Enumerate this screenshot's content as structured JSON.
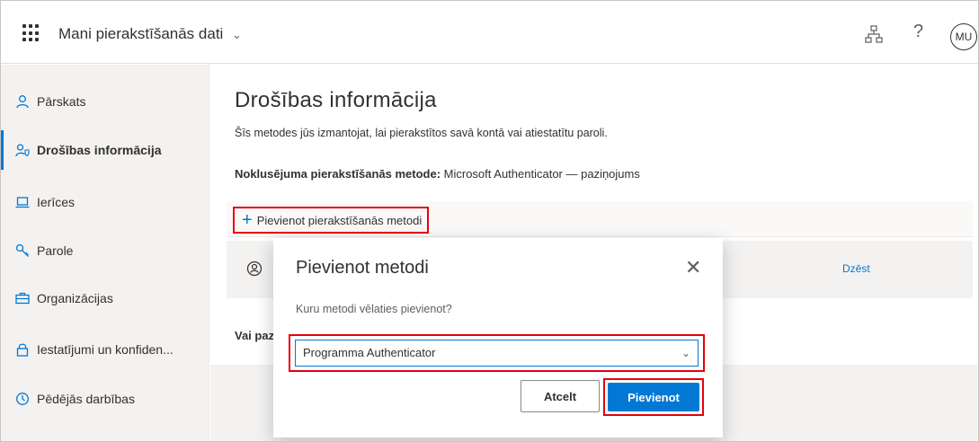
{
  "header": {
    "app_title": "Mani pierakstīšanās dati",
    "avatar_initials": "MU",
    "help_glyph": "?"
  },
  "sidebar": {
    "items": [
      {
        "label": "Pārskats",
        "icon": "person-icon",
        "active": false
      },
      {
        "label": "Drošības informācija",
        "icon": "security-info-icon",
        "active": true
      },
      {
        "label": "Ierīces",
        "icon": "laptop-icon",
        "active": false
      },
      {
        "label": "Parole",
        "icon": "key-icon",
        "active": false
      },
      {
        "label": "Organizācijas",
        "icon": "briefcase-icon",
        "active": false
      },
      {
        "label": "Iestatījumi un konfiden...",
        "icon": "lock-icon",
        "active": false
      },
      {
        "label": "Pēdējās darbības",
        "icon": "history-icon",
        "active": false
      }
    ]
  },
  "main": {
    "title": "Drošības informācija",
    "description": "Šīs metodes jūs izmantojat, lai pierakstītos savā kontā vai atiestatītu paroli.",
    "default_method_label": "Noklusējuma pierakstīšanās metode:",
    "default_method_value": "Microsoft Authenticator — paziņojums",
    "add_method_label": "Pievienot pierakstīšanās metodi",
    "delete_label": "Dzēst",
    "lost_device_label": "Vai paz"
  },
  "modal": {
    "title": "Pievienot metodi",
    "question": "Kuru metodi vēlaties pievienot?",
    "selected_option": "Programma Authenticator",
    "cancel_label": "Atcelt",
    "add_label": "Pievienot"
  },
  "colors": {
    "accent": "#0078d4",
    "highlight": "#e8000b",
    "sidebar_bg": "#f3f2f1"
  }
}
